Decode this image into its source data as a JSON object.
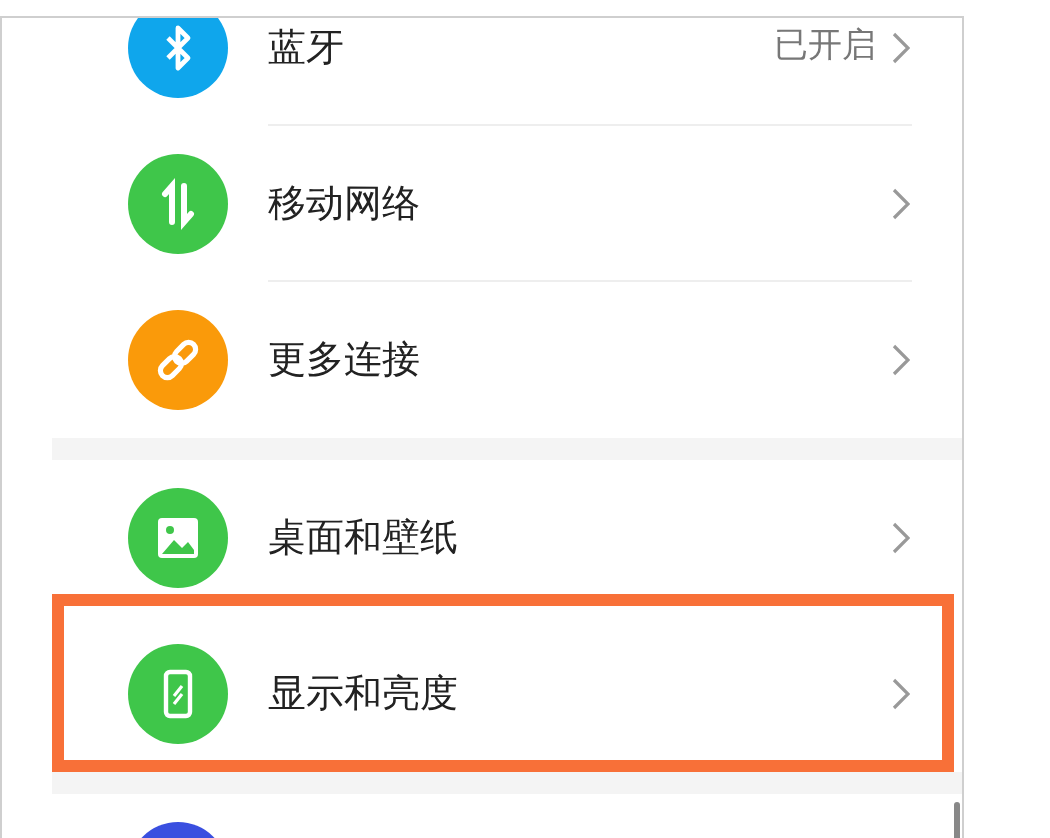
{
  "groups": [
    {
      "items": [
        {
          "kind": "bluetooth",
          "color": "#0fa6ec",
          "label": "蓝牙",
          "value": "已开启",
          "highlighted": false
        },
        {
          "kind": "arrows",
          "color": "#3fc64a",
          "label": "移动网络",
          "highlighted": false
        },
        {
          "kind": "link",
          "color": "#fa9a0a",
          "label": "更多连接",
          "highlighted": false
        }
      ]
    },
    {
      "items": [
        {
          "kind": "image",
          "color": "#3fc64a",
          "label": "桌面和壁纸",
          "highlighted": false
        },
        {
          "kind": "phone",
          "color": "#3fc64a",
          "label": "显示和亮度",
          "highlighted": true
        }
      ]
    },
    {
      "items": [
        {
          "kind": "blank",
          "color": "#3a4fe0",
          "highlighted": false
        }
      ]
    }
  ]
}
